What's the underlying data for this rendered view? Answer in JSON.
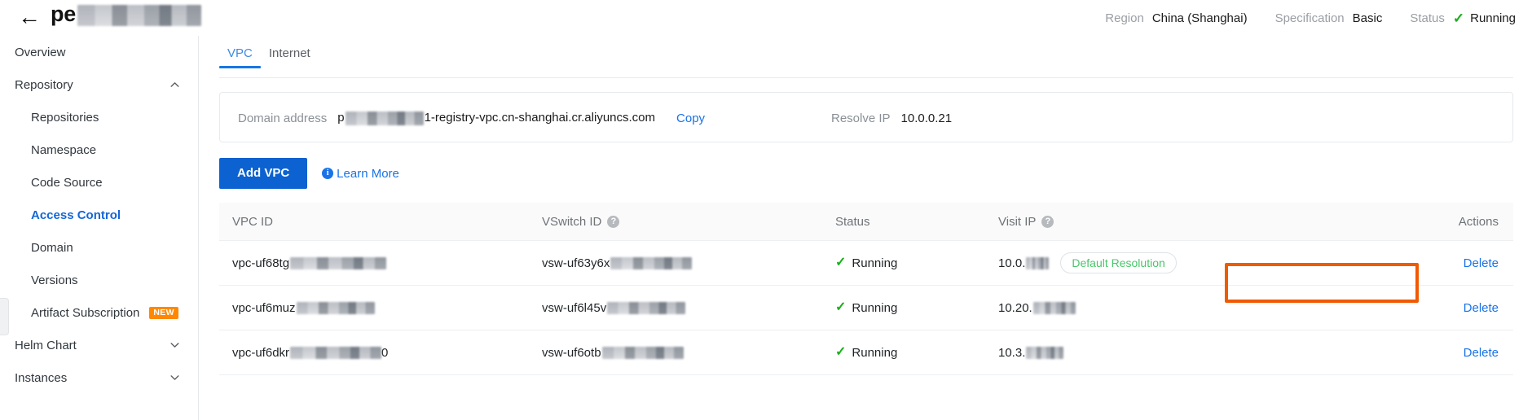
{
  "header": {
    "back_icon": "back-arrow-icon",
    "title_prefix": "pe",
    "title_redacted": true,
    "meta": [
      {
        "label": "Region",
        "value": "China (Shanghai)"
      },
      {
        "label": "Specification",
        "value": "Basic"
      },
      {
        "label": "Status",
        "value": "Running",
        "icon": "check-icon",
        "icon_color": "#18b018"
      }
    ]
  },
  "sidebar": {
    "items": [
      {
        "label": "Overview",
        "level": "top",
        "active": false
      },
      {
        "label": "Repository",
        "level": "top",
        "active": false,
        "chevron": "chevron-up-icon",
        "expanded": true
      },
      {
        "label": "Repositories",
        "level": "child",
        "active": false
      },
      {
        "label": "Namespace",
        "level": "child",
        "active": false
      },
      {
        "label": "Code Source",
        "level": "child",
        "active": false
      },
      {
        "label": "Access Control",
        "level": "child",
        "active": true
      },
      {
        "label": "Domain",
        "level": "child",
        "active": false
      },
      {
        "label": "Versions",
        "level": "child",
        "active": false
      },
      {
        "label": "Artifact Subscription",
        "level": "child",
        "active": false,
        "badge": "NEW"
      },
      {
        "label": "Helm Chart",
        "level": "top",
        "active": false,
        "chevron": "chevron-down-icon",
        "expanded": false
      },
      {
        "label": "Instances",
        "level": "top",
        "active": false,
        "chevron": "chevron-down-icon",
        "expanded": false
      }
    ],
    "collapse_handle": "sidebar-collapse-handle"
  },
  "tabs": [
    {
      "label": "VPC",
      "active": true
    },
    {
      "label": "Internet",
      "active": false
    }
  ],
  "info_panel": {
    "domain_label": "Domain address",
    "domain_prefix": "p",
    "domain_suffix": "1-registry-vpc.cn-shanghai.cr.aliyuncs.com",
    "copy_label": "Copy",
    "resolve_label": "Resolve IP",
    "resolve_value": "10.0.0.21"
  },
  "toolbar": {
    "add_vpc_label": "Add VPC",
    "learn_more_label": "Learn More",
    "info_icon": "info-circle-icon"
  },
  "table": {
    "columns": [
      {
        "label": "VPC ID",
        "help": false
      },
      {
        "label": "VSwitch ID",
        "help": true
      },
      {
        "label": "Status",
        "help": false
      },
      {
        "label": "Visit IP",
        "help": true
      },
      {
        "label": "Actions",
        "help": false
      }
    ],
    "rows": [
      {
        "vpc_id": "vpc-uf68tg",
        "vpc_redact_width": 118,
        "vswitch_id": "vsw-uf63y6x",
        "vswitch_redact_width": 100,
        "status": "Running",
        "status_icon": "check-icon",
        "visit_ip": "10.0.",
        "ip_redact_width": 28,
        "ip_suffix": "",
        "pill": "Default Resolution",
        "highlighted": true,
        "action": "Delete"
      },
      {
        "vpc_id": "vpc-uf6muz",
        "vpc_redact_width": 96,
        "vswitch_id": "vsw-uf6l45v",
        "vswitch_redact_width": 96,
        "status": "Running",
        "status_icon": "check-icon",
        "visit_ip": "10.20.",
        "ip_redact_width": 52,
        "ip_suffix": "",
        "pill": "",
        "highlighted": false,
        "action": "Delete"
      },
      {
        "vpc_id": "vpc-uf6dkr",
        "vpc_redact_width": 112,
        "vswitch_id": "vsw-uf6otb",
        "vswitch_redact_width": 100,
        "status": "Running",
        "status_icon": "check-icon",
        "visit_ip": "10.3.",
        "ip_redact_width": 46,
        "ip_suffix": "",
        "pill": "",
        "highlighted": false,
        "action": "Delete"
      }
    ],
    "row3_vpc_tail": "0"
  },
  "annotation": {
    "color": "#f05a00",
    "target": "visit-ip-cell-row-1"
  }
}
